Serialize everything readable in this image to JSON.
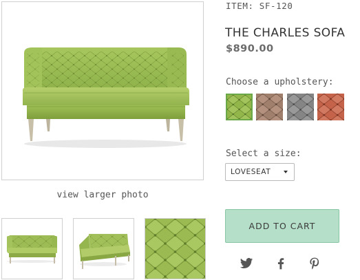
{
  "product": {
    "item_code": "ITEM: SF-120",
    "title": "THE CHARLES SOFA",
    "price": "$890.00"
  },
  "gallery": {
    "view_larger": "view larger photo",
    "thumbnails": [
      "sofa-front",
      "sofa-angle",
      "fabric-closeup"
    ]
  },
  "upholstery": {
    "label": "Choose a upholstery:",
    "options": [
      {
        "name": "green",
        "color": "#95b84b",
        "selected": true
      },
      {
        "name": "taupe",
        "color": "#a88672",
        "selected": false
      },
      {
        "name": "grey",
        "color": "#8a8a8a",
        "selected": false
      },
      {
        "name": "coral",
        "color": "#c8684f",
        "selected": false
      }
    ]
  },
  "size": {
    "label": "Select a size:",
    "selected": "LOVESEAT"
  },
  "cart": {
    "add_label": "ADD TO CART"
  },
  "social": [
    "twitter-icon",
    "facebook-icon",
    "pinterest-icon"
  ],
  "colors": {
    "accent": "#b6dfc9",
    "accent_border": "#86c6a3",
    "selected_swatch_border": "#6aa84a",
    "sofa_green": "#9cbd52"
  }
}
